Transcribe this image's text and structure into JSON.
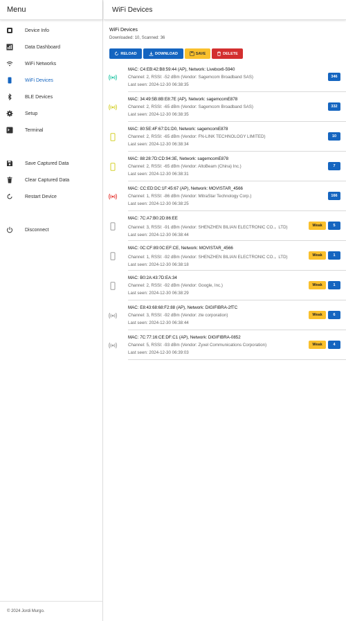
{
  "sidebar": {
    "title": "Menu",
    "items": [
      {
        "label": "Device Info",
        "icon": "chip-icon"
      },
      {
        "label": "Data Dashboard",
        "icon": "bar-chart-icon"
      },
      {
        "label": "WiFi Networks",
        "icon": "wifi-icon"
      },
      {
        "label": "WiFi Devices",
        "icon": "phone-icon"
      },
      {
        "label": "BLE Devices",
        "icon": "bluetooth-icon"
      },
      {
        "label": "Setup",
        "icon": "gear-icon"
      },
      {
        "label": "Terminal",
        "icon": "terminal-icon"
      },
      {
        "label": "Save Captured Data",
        "icon": "floppy-icon"
      },
      {
        "label": "Clear Captured Data",
        "icon": "trash-icon"
      },
      {
        "label": "Restart Device",
        "icon": "restart-icon"
      },
      {
        "label": "Disconnect",
        "icon": "power-icon"
      }
    ],
    "active_index": 3,
    "footer": "© 2024 Jordi Murgo."
  },
  "main": {
    "header_title": "WiFi Devices",
    "section_title": "WiFi Devices",
    "section_sub": "Downloaded: 10, Scanned: 36",
    "buttons": {
      "reload": "RELOAD",
      "download": "DOWNLOAD",
      "save": "SAVE",
      "delete": "DELETE"
    },
    "weak_label": "Weak",
    "colors": {
      "accent": "#1565c0",
      "save": "#f9c02d",
      "delete": "#d32f2f",
      "ap_teal": "#26c6a6",
      "ap_yellow": "#d4d02a",
      "ap_red": "#e53935",
      "weak": "#f9c02d",
      "gray": "#9e9e9e"
    },
    "devices": [
      {
        "line1": "MAC: C4:EB:42:B8:59:44 (AP), Network: Livebox6-5940",
        "line2": "Channel: 2, RSSI: -52 dBm (Vendor: Sagemcom Broadband SAS)",
        "line3": "Last seen: 2024-12-30 06:38:35",
        "count": "346",
        "weak": false,
        "icon": "ap-icon",
        "icon_color": "#26c6a6"
      },
      {
        "line1": "MAC: 34:49:5B:8B:E8:7E (AP), Network: sagemcomE878",
        "line2": "Channel: 2, RSSI: -65 dBm (Vendor: Sagemcom Broadband SAS)",
        "line3": "Last seen: 2024-12-30 06:38:35",
        "count": "332",
        "weak": false,
        "icon": "ap-icon",
        "icon_color": "#d4d02a"
      },
      {
        "line1": "MAC: 80:5E:4F:67:D1:D0, Network: sagemcomE878",
        "line2": "Channel: 2, RSSI: -65 dBm (Vendor: FN-LINK TECHNOLOGY LIMITED)",
        "line3": "Last seen: 2024-12-30 06:38:34",
        "count": "10",
        "weak": false,
        "icon": "phone-icon",
        "icon_color": "#d4d02a"
      },
      {
        "line1": "MAC: 88:28:7D:CD:94:3E, Network: sagemcomE878",
        "line2": "Channel: 2, RSSI: -65 dBm (Vendor: AltoBeam (China) Inc.)",
        "line3": "Last seen: 2024-12-30 06:38:31",
        "count": "7",
        "weak": false,
        "icon": "phone-icon",
        "icon_color": "#d4d02a"
      },
      {
        "line1": "MAC: CC:ED:DC:1F:45:67 (AP), Network: MOVISTAR_4566",
        "line2": "Channel: 1, RSSI: -86 dBm (Vendor: MitraStar Technology Corp.)",
        "line3": "Last seen: 2024-12-30 06:38:25",
        "count": "166",
        "weak": false,
        "icon": "ap-icon",
        "icon_color": "#e53935"
      },
      {
        "line1": "MAC: 7C:A7:B0:2D:86:EE",
        "line2": "Channel: 3, RSSI: -91 dBm (Vendor: SHENZHEN BILIAN ELECTRONIC CO.，LTD)",
        "line3": "Last seen: 2024-12-30 06:38:44",
        "count": "5",
        "weak": true,
        "icon": "phone-icon",
        "icon_color": "#9e9e9e"
      },
      {
        "line1": "MAC: 0C:CF:89:0C:EF:CE, Network: MOVISTAR_4566",
        "line2": "Channel: 1, RSSI: -92 dBm (Vendor: SHENZHEN BILIAN ELECTRONIC CO.，LTD)",
        "line3": "Last seen: 2024-12-30 06:38:18",
        "count": "1",
        "weak": true,
        "icon": "phone-icon",
        "icon_color": "#9e9e9e"
      },
      {
        "line1": "MAC: B0:2A:43:7D:EA:34",
        "line2": "Channel: 2, RSSI: -92 dBm (Vendor: Google, Inc.)",
        "line3": "Last seen: 2024-12-30 06:38:29",
        "count": "1",
        "weak": true,
        "icon": "phone-icon",
        "icon_color": "#9e9e9e"
      },
      {
        "line1": "MAC: E8:43:68:68:F2:88 (AP), Network: DIGIFIBRA-2fTC",
        "line2": "Channel: 3, RSSI: -92 dBm (Vendor: zte corporation)",
        "line3": "Last seen: 2024-12-30 06:38:44",
        "count": "6",
        "weak": true,
        "icon": "ap-icon",
        "icon_color": "#9e9e9e"
      },
      {
        "line1": "MAC: 7C:77:16:CE:DF:C1 (AP), Network: DIGIFIBRA-0852",
        "line2": "Channel: 5, RSSI: -93 dBm (Vendor: Zyxel Communications Corporation)",
        "line3": "Last seen: 2024-12-30 06:39:03",
        "count": "4",
        "weak": true,
        "icon": "ap-icon",
        "icon_color": "#9e9e9e"
      }
    ]
  }
}
